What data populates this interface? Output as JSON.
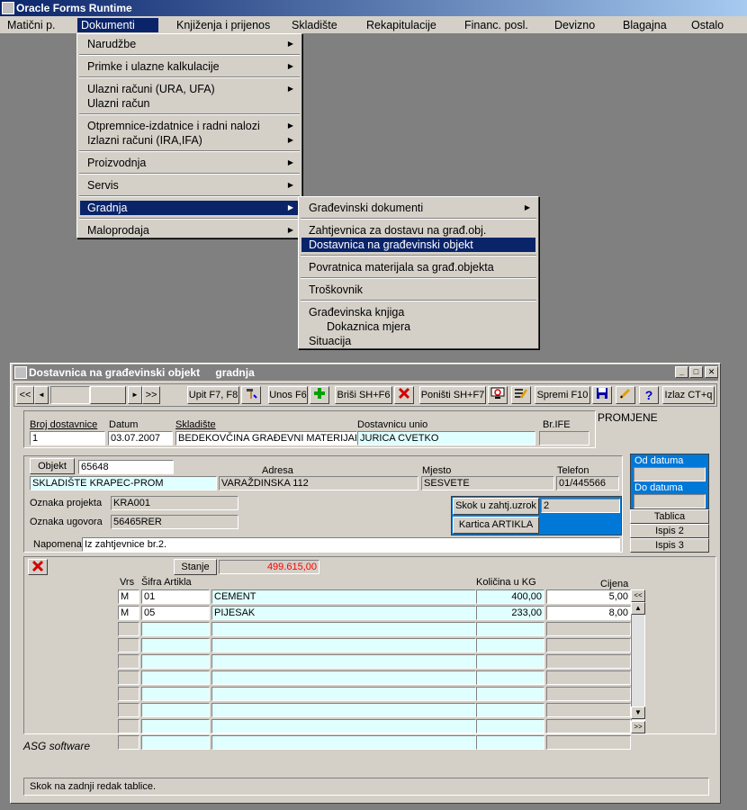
{
  "app_title": "Oracle Forms Runtime",
  "menubar": [
    {
      "label": "Matični p.",
      "active": false
    },
    {
      "label": "Dokumenti",
      "active": true
    },
    {
      "label": "Knjiženja i prijenos",
      "active": false
    },
    {
      "label": "Skladište",
      "active": false
    },
    {
      "label": "Rekapitulacije",
      "active": false
    },
    {
      "label": "Financ. posl.",
      "active": false
    },
    {
      "label": "Devizno",
      "active": false
    },
    {
      "label": "Blagajna",
      "active": false
    },
    {
      "label": "Ostalo",
      "active": false
    }
  ],
  "dokumenti_menu": [
    {
      "label": "Narudžbe",
      "arrow": true
    },
    {
      "label": "Primke i ulazne kalkulacije",
      "arrow": true
    },
    {
      "label": "Ulazni računi (URA, UFA)",
      "arrow": true
    },
    {
      "label": "Ulazni račun",
      "arrow": false
    },
    {
      "label": "Otpremnice-izdatnice i  radni nalozi",
      "arrow": true
    },
    {
      "label": "Izlazni računi (IRA,IFA)",
      "arrow": true
    },
    {
      "label": "Proizvodnja",
      "arrow": true
    },
    {
      "label": "Servis",
      "arrow": true
    },
    {
      "label": "Gradnja",
      "arrow": true,
      "selected": true
    },
    {
      "label": "Maloprodaja",
      "arrow": true
    }
  ],
  "gradnja_menu": [
    {
      "label": "Građevinski dokumenti",
      "arrow": true
    },
    {
      "label": "Zahtjevnica za dostavu na građ.obj.",
      "arrow": false
    },
    {
      "label": "Dostavnica na građevinski objekt",
      "arrow": false,
      "selected": true
    },
    {
      "label": "Povratnica materijala sa građ.objekta",
      "arrow": false
    },
    {
      "label": "Troškovnik",
      "arrow": false
    },
    {
      "label": "Građevinska knjiga",
      "arrow": false
    },
    {
      "label": "Dokaznica mjera",
      "arrow": false
    },
    {
      "label": "Situacija",
      "arrow": false
    }
  ],
  "window": {
    "title": "Dostavnica na građevinski objekt",
    "subtitle": "gradnja",
    "toolbar": {
      "first": "<<",
      "prev": "◄",
      "next": "►",
      "last": ">>",
      "query": "Upit F7, F8",
      "insert": "Unos F6",
      "delete": "Briši  SH+F6",
      "cancel": "Poništi SH+F7",
      "save": "Spremi F10",
      "exit": "Izlaz CT+q",
      "help": "?"
    },
    "header": {
      "broj_label": "Broj dostavnice",
      "broj": "1",
      "datum_label": "Datum",
      "datum": "03.07.2007",
      "skladiste_label": "Skladište",
      "skladiste": "BEDEKOVČINA  GRAĐEVNI MATERIJAL",
      "unio_label": "Dostavnicu unio",
      "unio": "JURICA CVETKO",
      "brife_label": "Br.IFE",
      "brife": "",
      "promjene": "PROMJENE"
    },
    "objekt": {
      "button": "Objekt",
      "code": "65648",
      "naziv": "SKLADIŠTE KRAPEC-PROM",
      "adresa_label": "Adresa",
      "adresa": "VARAŽDINSKA 112",
      "mjesto_label": "Mjesto",
      "mjesto": "SESVETE",
      "telefon_label": "Telefon",
      "telefon": "01/445566",
      "projekt_label": "Oznaka projekta",
      "projekt": "KRA001",
      "ugovor_label": "Oznaka ugovora",
      "ugovor": "56465RER",
      "napomena_label": "Napomena",
      "napomena": "Iz zahtjevnice br.2.",
      "skok_button": "Skok u zahtj.uzrok",
      "skok_value": "2",
      "kartica_button": "Kartica ARTIKLA"
    },
    "side": {
      "od_label": "Od datuma",
      "do_label": "Do datuma",
      "tablica": "Tablica",
      "ispis2": "Ispis 2",
      "ispis3": "Ispis 3"
    },
    "items": {
      "stanje_button": "Stanje",
      "stanje_value": "499.615,00",
      "cols": {
        "vrs": "Vrs",
        "sifra": "Šifra Artikla",
        "kolicina": "Količina u KG",
        "cijena": "Cijena"
      },
      "rows": [
        {
          "vrs": "M",
          "sifra": "01",
          "naziv": "CEMENT",
          "kolicina": "400,00",
          "cijena": "5,00"
        },
        {
          "vrs": "M",
          "sifra": "05",
          "naziv": "PIJESAK",
          "kolicina": "233,00",
          "cijena": "8,00"
        }
      ],
      "empty_rows": 8,
      "btn_up": "<<",
      "btn_down": ">>"
    },
    "footer": "ASG software",
    "status": "Skok na zadnji redak tablice."
  },
  "colors": {
    "titlebar": "#0a246a",
    "stanje_red": "#ff0000",
    "highlight": "#0078d7",
    "field_cyan": "#e0ffff"
  }
}
